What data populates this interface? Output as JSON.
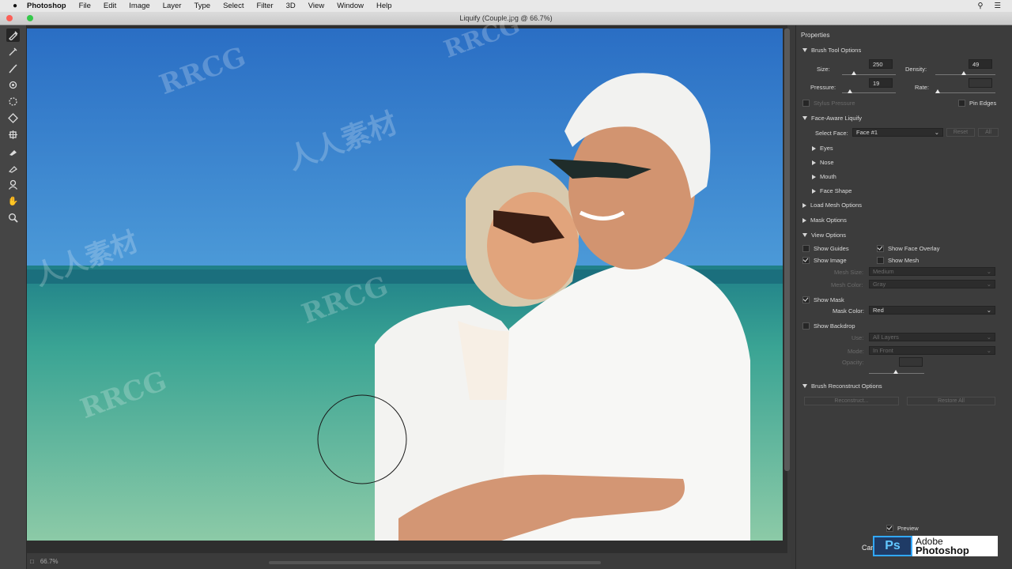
{
  "menubar": {
    "items": [
      "Photoshop",
      "File",
      "Edit",
      "Image",
      "Layer",
      "Type",
      "Select",
      "Filter",
      "3D",
      "View",
      "Window",
      "Help"
    ]
  },
  "window": {
    "title": "Liquify (Couple.jpg @ 66.7%)"
  },
  "statusbar": {
    "zoom": "66.7%"
  },
  "panel": {
    "title": "Properties",
    "brush_tool_options": {
      "header": "Brush Tool Options",
      "size_label": "Size:",
      "size_value": "250",
      "density_label": "Density:",
      "density_value": "49",
      "pressure_label": "Pressure:",
      "pressure_value": "19",
      "rate_label": "Rate:",
      "stylus_pressure": "Stylus Pressure",
      "pin_edges": "Pin Edges"
    },
    "face_aware": {
      "header": "Face-Aware Liquify",
      "select_face_label": "Select Face:",
      "select_face_value": "Face #1",
      "reset": "Reset",
      "all": "All",
      "items": [
        "Eyes",
        "Nose",
        "Mouth",
        "Face Shape"
      ]
    },
    "load_mesh_options": "Load Mesh Options",
    "mask_options": "Mask Options",
    "view_options": {
      "header": "View Options",
      "show_guides": "Show Guides",
      "show_face_overlay": "Show Face Overlay",
      "show_image": "Show Image",
      "show_mesh": "Show Mesh",
      "mesh_size_label": "Mesh Size:",
      "mesh_size_value": "Medium",
      "mesh_color_label": "Mesh Color:",
      "mesh_color_value": "Gray",
      "show_mask": "Show Mask",
      "mask_color_label": "Mask Color:",
      "mask_color_value": "Red",
      "show_backdrop": "Show Backdrop",
      "use_label": "Use:",
      "use_value": "All Layers",
      "mode_label": "Mode:",
      "mode_value": "In Front",
      "opacity_label": "Opacity:"
    },
    "brush_reconstruct": {
      "header": "Brush Reconstruct Options",
      "reconstruct": "Reconstruct...",
      "restore_all": "Restore All"
    },
    "preview": "Preview",
    "cancel": "Can"
  },
  "logo": {
    "ps": "Ps",
    "line1": "Adobe",
    "line2": "Photoshop"
  },
  "watermarks": [
    "RRCG",
    "人人素材"
  ],
  "colors": {
    "sky_top": "#2a6ec4",
    "sea": "#1f8a86",
    "sand": "#7fc2a3"
  }
}
